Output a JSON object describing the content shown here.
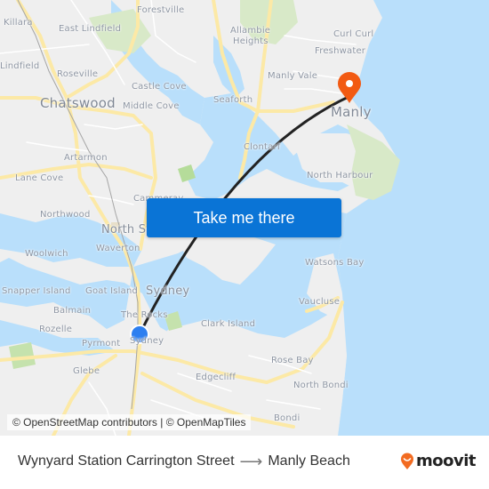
{
  "map": {
    "labels": {
      "killara": "Killara",
      "east_lindfield": "East Lindfield",
      "forestville": "Forestville",
      "allambie_1": "Allambie",
      "allambie_2": "Heights",
      "curl_curl": "Curl Curl",
      "freshwater": "Freshwater",
      "lindfield": "Lindfield",
      "roseville": "Roseville",
      "manly_vale": "Manly Vale",
      "castle_cove": "Castle Cove",
      "chatswood": "Chatswood",
      "middle_cove": "Middle Cove",
      "seaforth": "Seaforth",
      "manly": "Manly",
      "clontarf": "Clontarf",
      "artarmon": "Artarmon",
      "north_harbour": "North Harbour",
      "lane_cove": "Lane Cove",
      "cammeray": "Cammeray",
      "northwood": "Northwood",
      "north_sydney": "North Sydney",
      "waverton": "Waverton",
      "woolwich": "Woolwich",
      "watsons_bay": "Watsons Bay",
      "snapper_island": "Snapper Island",
      "goat_island": "Goat Island",
      "sydney": "Sydney",
      "vaucluse": "Vaucluse",
      "balmain": "Balmain",
      "the_rocks": "The Rocks",
      "rozelle": "Rozelle",
      "clark_island": "Clark Island",
      "pyrmont": "Pyrmont",
      "sydney_small": "Sydney",
      "rose_bay": "Rose Bay",
      "glebe": "Glebe",
      "edgecliff": "Edgecliff",
      "north_bondi": "North Bondi",
      "bondi": "Bondi"
    },
    "origin_marker": {
      "icon": "origin-dot",
      "color": "#2d7ff0"
    },
    "destination_marker": {
      "icon": "map-pin",
      "color": "#f25a12"
    },
    "route_line_color": "#222222",
    "take_me_there": "Take me there",
    "attribution": "© OpenStreetMap contributors | © OpenMapTiles"
  },
  "footer": {
    "origin": "Wynyard Station Carrington Street",
    "arrow": "⟶",
    "destination": "Manly Beach",
    "brand": "moovit",
    "brand_color": "#f26b21"
  }
}
